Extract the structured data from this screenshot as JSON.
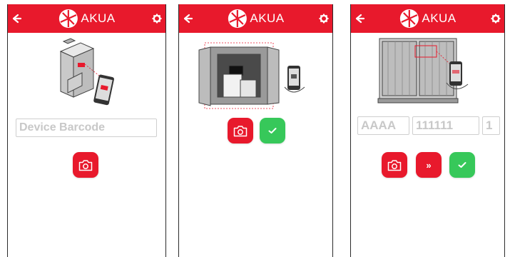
{
  "app": {
    "brand": "AKUA"
  },
  "colors": {
    "brand_red": "#e8192c",
    "confirm_green": "#37c85a",
    "border": "#cfcfcf"
  },
  "icons": {
    "back": "arrow-left-icon",
    "settings": "gear-icon",
    "logo": "akua-logo-icon",
    "camera": "camera-icon",
    "confirm": "check-icon",
    "skip": "double-chevron-right-icon"
  },
  "screen1": {
    "barcode_field": {
      "placeholder": "Device Barcode",
      "value": ""
    }
  },
  "screen3": {
    "owner_code": {
      "placeholder": "AAAA",
      "value": ""
    },
    "serial_number": {
      "placeholder": "111111",
      "value": ""
    },
    "check_digit": {
      "placeholder": "1",
      "value": ""
    },
    "skip_label": "»"
  }
}
